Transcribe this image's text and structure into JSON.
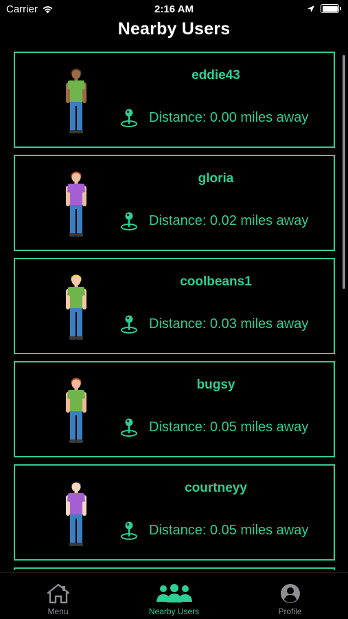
{
  "status_bar": {
    "carrier": "Carrier",
    "time": "2:16 AM"
  },
  "header": {
    "title": "Nearby Users"
  },
  "users": [
    {
      "username": "eddie43",
      "distance": "Distance: 0.00 miles away",
      "avatar": {
        "skin": "#9a6a46",
        "hair": "#4a2f1b",
        "shirt": "#6fb54a"
      }
    },
    {
      "username": "gloria",
      "distance": "Distance: 0.02 miles away",
      "avatar": {
        "skin": "#e9bfa0",
        "hair": "#b5462b",
        "shirt": "#a45fd4"
      }
    },
    {
      "username": "coolbeans1",
      "distance": "Distance: 0.03 miles away",
      "avatar": {
        "skin": "#f3c9a6",
        "hair": "#f4d34f",
        "shirt": "#6fb54a"
      }
    },
    {
      "username": "bugsy",
      "distance": "Distance: 0.05 miles away",
      "avatar": {
        "skin": "#f0b994",
        "hair": "#b5462b",
        "shirt": "#6fb54a"
      }
    },
    {
      "username": "courtneyy",
      "distance": "Distance: 0.05 miles away",
      "avatar": {
        "skin": "#f6d6c2",
        "hair": "#1a1a1a",
        "shirt": "#a45fd4"
      }
    }
  ],
  "tabs": [
    {
      "label": "Menu",
      "icon": "house-icon",
      "active": false
    },
    {
      "label": "Nearby Users",
      "icon": "users-icon",
      "active": true
    },
    {
      "label": "Profile",
      "icon": "person-circle-icon",
      "active": false
    }
  ],
  "colors": {
    "accent": "#2ecf93",
    "background": "#000000",
    "inactive": "#8e8e93"
  }
}
